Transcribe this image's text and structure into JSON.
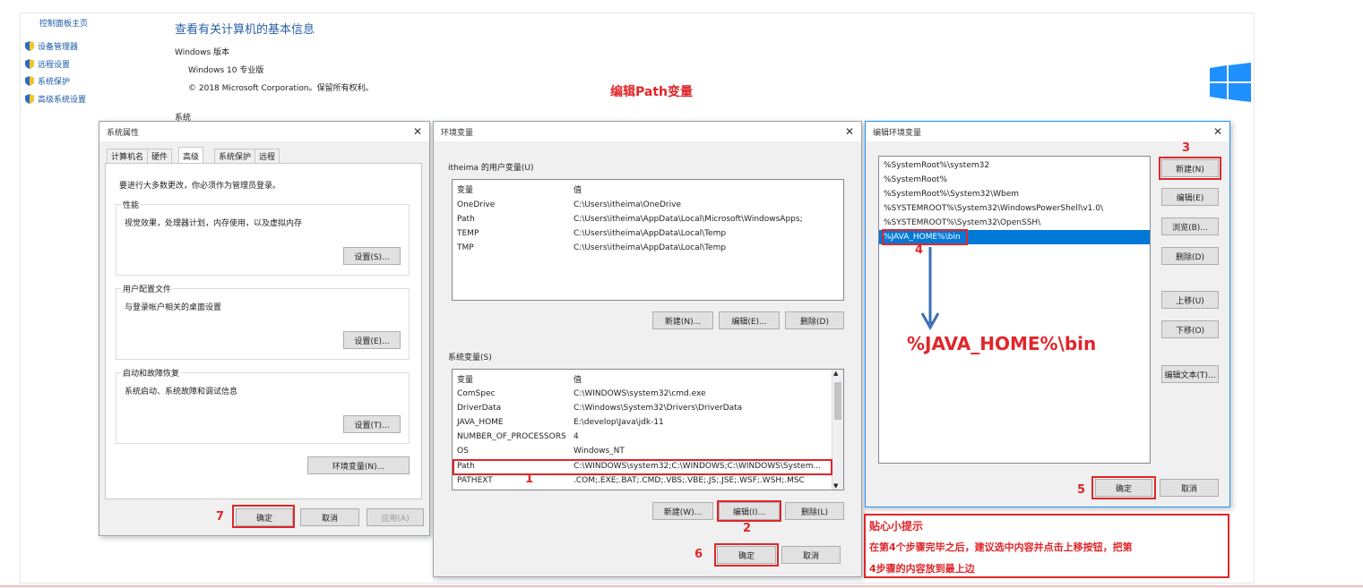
{
  "control_panel": {
    "home_link": "控制面板主页",
    "links": [
      "设备管理器",
      "远程设置",
      "系统保护",
      "高级系统设置"
    ],
    "page_title": "查看有关计算机的基本信息",
    "windows_edition_heading": "Windows 版本",
    "edition": "Windows 10 专业版",
    "copyright": "© 2018 Microsoft Corporation。保留所有权利。",
    "system_heading": "系统"
  },
  "annotation_title": "编辑Path变量",
  "system_properties": {
    "title": "系统属性",
    "tabs": [
      "计算机名",
      "硬件",
      "高级",
      "系统保护",
      "远程"
    ],
    "active_tab": "高级",
    "admin_note": "要进行大多数更改，你必须作为管理员登录。",
    "performance": {
      "label": "性能",
      "desc": "视觉效果，处理器计划，内存使用，以及虚拟内存",
      "button": "设置(S)..."
    },
    "user_profile": {
      "label": "用户配置文件",
      "desc": "与登录帐户相关的桌面设置",
      "button": "设置(E)..."
    },
    "startup": {
      "label": "启动和故障恢复",
      "desc": "系统启动、系统故障和调试信息",
      "button": "设置(T)..."
    },
    "env_button": "环境变量(N)...",
    "ok": "确定",
    "cancel": "取消",
    "apply": "应用(A)"
  },
  "env_vars": {
    "title": "环境变量",
    "user_section": "itheima 的用户变量(U)",
    "col_var": "变量",
    "col_val": "值",
    "user_rows": [
      {
        "name": "OneDrive",
        "value": "C:\\Users\\itheima\\OneDrive"
      },
      {
        "name": "Path",
        "value": "C:\\Users\\itheima\\AppData\\Local\\Microsoft\\WindowsApps;"
      },
      {
        "name": "TEMP",
        "value": "C:\\Users\\itheima\\AppData\\Local\\Temp"
      },
      {
        "name": "TMP",
        "value": "C:\\Users\\itheima\\AppData\\Local\\Temp"
      }
    ],
    "user_buttons": [
      "新建(N)...",
      "编辑(E)...",
      "删除(D)"
    ],
    "system_section": "系统变量(S)",
    "system_rows": [
      {
        "name": "ComSpec",
        "value": "C:\\WINDOWS\\system32\\cmd.exe"
      },
      {
        "name": "DriverData",
        "value": "C:\\Windows\\System32\\Drivers\\DriverData"
      },
      {
        "name": "JAVA_HOME",
        "value": "E:\\develop\\Java\\jdk-11"
      },
      {
        "name": "NUMBER_OF_PROCESSORS",
        "value": "4"
      },
      {
        "name": "OS",
        "value": "Windows_NT"
      },
      {
        "name": "Path",
        "value": "C:\\WINDOWS\\system32;C:\\WINDOWS;C:\\WINDOWS\\System..."
      },
      {
        "name": "PATHEXT",
        "value": ".COM;.EXE;.BAT;.CMD;.VBS;.VBE;.JS;.JSE;.WSF;.WSH;.MSC"
      }
    ],
    "system_buttons": [
      "新建(W)...",
      "编辑(I)...",
      "删除(L)"
    ],
    "ok": "确定",
    "cancel": "取消"
  },
  "edit_env": {
    "title": "编辑环境变量",
    "items": [
      "%SystemRoot%\\system32",
      "%SystemRoot%",
      "%SystemRoot%\\System32\\Wbem",
      "%SYSTEMROOT%\\System32\\WindowsPowerShell\\v1.0\\",
      "%SYSTEMROOT%\\System32\\OpenSSH\\",
      "%JAVA_HOME%\\bin"
    ],
    "selected_index": 5,
    "buttons": [
      "新建(N)",
      "编辑(E)",
      "浏览(B)...",
      "删除(D)",
      "上移(U)",
      "下移(O)",
      "编辑文本(T)..."
    ],
    "big_label": "%JAVA_HOME%\\bin",
    "ok": "确定",
    "cancel": "取消"
  },
  "tip": {
    "title": "贴心小提示",
    "line1": "在第4个步骤完毕之后，建议选中内容并点击上移按钮，把第",
    "line2": "4步骤的内容放到最上边"
  },
  "step_numbers": [
    "1",
    "2",
    "3",
    "4",
    "5",
    "6",
    "7"
  ],
  "colors": {
    "accent_red": "#e0262a",
    "link_blue": "#1a5aa6",
    "selection": "#0078d7",
    "arrow": "#3b6fb6"
  }
}
